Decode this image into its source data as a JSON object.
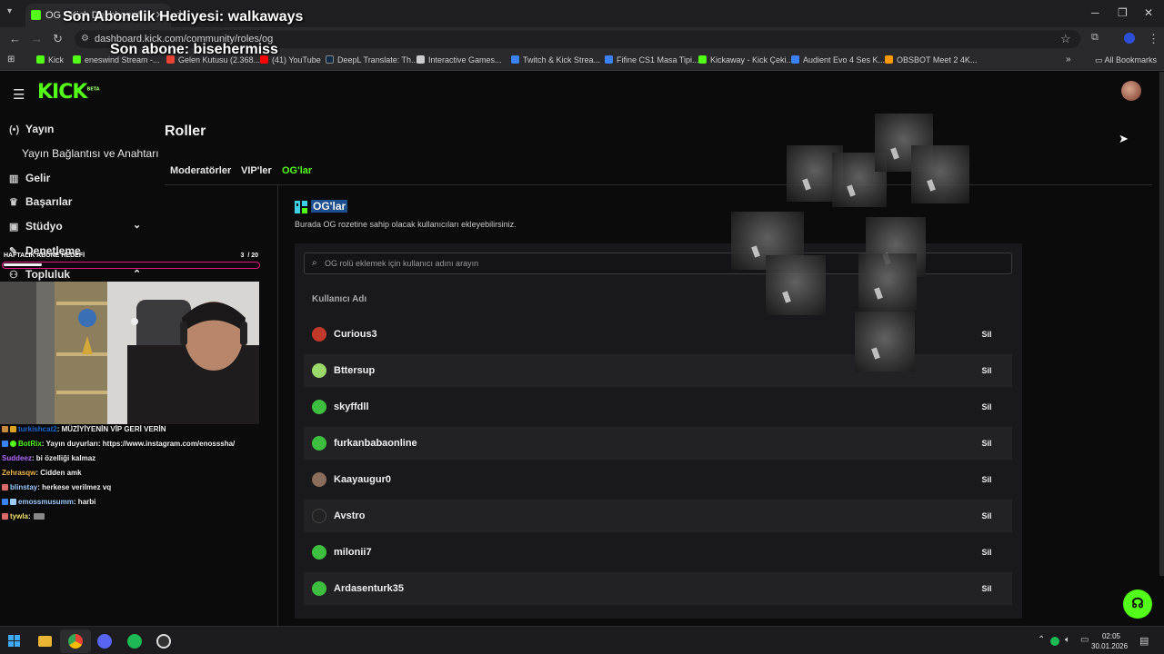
{
  "browser": {
    "tab_title": "OG - Kick Dashboard",
    "url": "dashboard.kick.com/community/roles/og",
    "bookmarks": [
      {
        "label": "Kick",
        "color": "#53fc18"
      },
      {
        "label": "eneswind Stream -...",
        "color": "#53fc18"
      },
      {
        "label": "Gelen Kutusu (2.368...",
        "color": "#ea4335"
      },
      {
        "label": "(41) YouTube",
        "color": "#ff0000"
      },
      {
        "label": "DeepL Translate: Th...",
        "color": "#0f2b46"
      },
      {
        "label": "Interactive Games...",
        "color": "#cccccc"
      },
      {
        "label": "Twitch & Kick Strea...",
        "color": "#3b82f6"
      },
      {
        "label": "Fifine CS1 Masa Tipi...",
        "color": "#3b82f6"
      },
      {
        "label": "Kickaway - Kick Çeki...",
        "color": "#53fc18"
      },
      {
        "label": "Audient Evo 4 Ses K...",
        "color": "#3b82f6"
      },
      {
        "label": "OBSBOT Meet 2 4K...",
        "color": "#ff9900"
      }
    ],
    "all_bookmarks": "All Bookmarks"
  },
  "kick": {
    "logo": "KICK",
    "logo_badge": "BETA",
    "sidebar": {
      "stream": "Yayın",
      "stream_keys": "Yayın Bağlantısı ve Anahtarı",
      "revenue": "Gelir",
      "achievements": "Başarılar",
      "studio": "Stüdyo",
      "moderation": "Denetleme",
      "community": "Topluluk"
    },
    "page_title": "Roller",
    "tabs": [
      "Moderatörler",
      "VIP'ler",
      "OG'lar"
    ],
    "section_title": "OG'lar",
    "section_desc": "Burada OG rozetine sahip olacak kullanıcıları ekleyebilirsiniz.",
    "search_placeholder": "OG rolü eklemek için kullanıcı adını arayın",
    "column_header": "Kullanıcı Adı",
    "remove_label": "Sil",
    "users": [
      {
        "name": "Curious3",
        "avatar": "#c0392b"
      },
      {
        "name": "Bttersup",
        "avatar": "#9bd86a"
      },
      {
        "name": "skyffdll",
        "avatar": "#3fbf3f"
      },
      {
        "name": "furkanbabaonline",
        "avatar": "#3fbf3f"
      },
      {
        "name": "Kaayaugur0",
        "avatar": "#8a6d5b"
      },
      {
        "name": "Avstro",
        "avatar": "#222222"
      },
      {
        "name": "milonii7",
        "avatar": "#3fbf3f"
      },
      {
        "name": "Ardasenturk35",
        "avatar": "#3fbf3f"
      }
    ]
  },
  "overlay": {
    "sub_gift": "Son Abonelik Hediyesi: walkaways",
    "last_sub": "Son abone: bisehermiss",
    "goal_label": "HAFTALIK ABONE HEDEFİ",
    "goal_count": "3",
    "goal_total": "/ 20",
    "goal_progress": 0.15,
    "chat": [
      {
        "user": "turkishcat2",
        "user_color": "#1a6bd8",
        "msg": ": MÜZİYİYENİN VİP GERİ VERİN"
      },
      {
        "user": "BotRix",
        "user_color": "#53fc18",
        "msg": ": Yayın duyurları: https://www.instagram.com/enosssha/"
      },
      {
        "user": "Suddeez",
        "user_color": "#b36bff",
        "msg": ": bi özelliği kalmaz"
      },
      {
        "user": "Zehrasqw",
        "user_color": "#f2b84b",
        "msg": ": Cidden amk"
      },
      {
        "user": "blinstay",
        "user_color": "#9ecbff",
        "msg": ": herkese verilmez vq"
      },
      {
        "user": "emossmusumm",
        "user_color": "#9ecbff",
        "msg": ": harbi"
      },
      {
        "user": "tywla",
        "user_color": "#f2e26b",
        "msg": ":"
      }
    ]
  },
  "taskbar": {
    "time": "02:05",
    "date": "30.01.2026"
  }
}
